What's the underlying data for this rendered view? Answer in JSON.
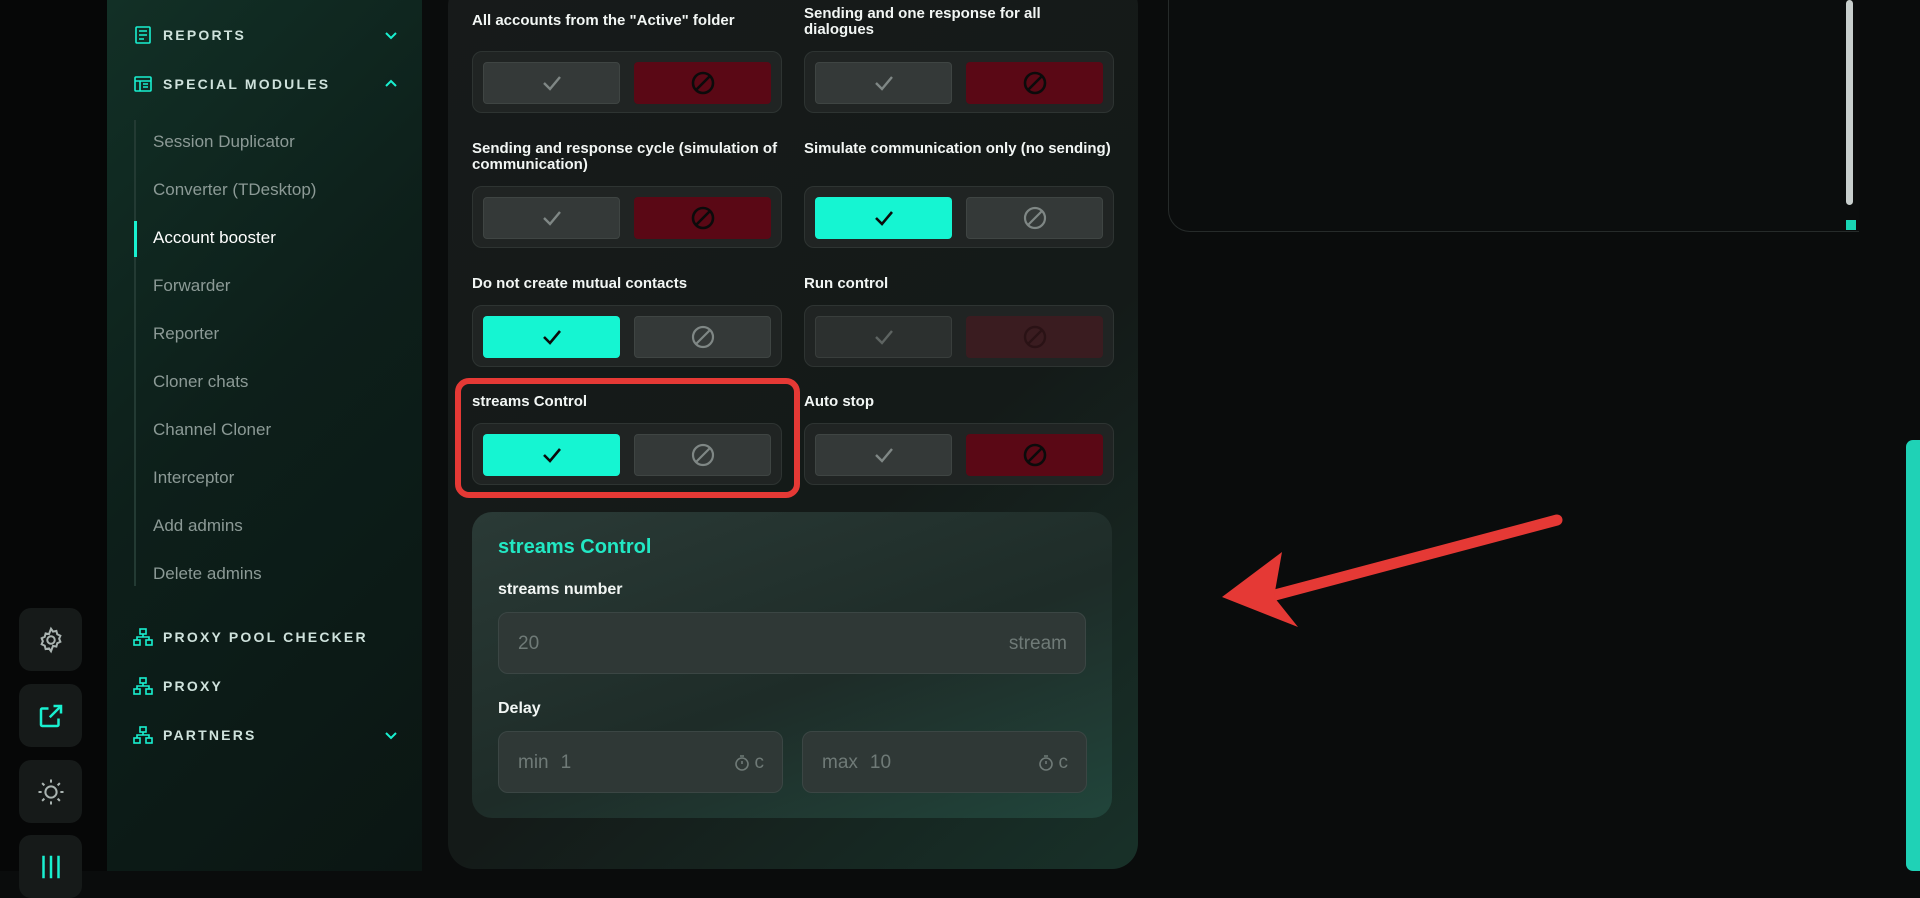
{
  "sidebar": {
    "sections": [
      {
        "title": "REPORTS",
        "icon": "report-icon",
        "expanded": false
      },
      {
        "title": "SPECIAL MODULES",
        "icon": "modules-icon",
        "expanded": true
      },
      {
        "title": "PROXY POOL CHECKER",
        "icon": "network-icon",
        "expanded": false
      },
      {
        "title": "PROXY",
        "icon": "network-icon",
        "expanded": false
      },
      {
        "title": "PARTNERS",
        "icon": "network-icon",
        "expanded": false
      }
    ],
    "submenu": [
      "Session Duplicator",
      "Converter (TDesktop)",
      "Account booster",
      "Forwarder",
      "Reporter",
      "Cloner chats",
      "Channel Cloner",
      "Interceptor",
      "Add admins",
      "Delete admins"
    ],
    "active_item": "Account booster"
  },
  "iconbar": [
    "gear-icon",
    "external-link-icon",
    "theme-icon",
    "sliders-icon"
  ],
  "options": [
    {
      "label": "All accounts from the \"Active\" folder",
      "state": "no"
    },
    {
      "label": "Sending and one response for all dialogues",
      "state": "no"
    },
    {
      "label": "Sending and response cycle (simulation of communication)",
      "state": "no"
    },
    {
      "label": "Simulate communication only (no sending)",
      "state": "yes"
    },
    {
      "label": "Do not create mutual contacts",
      "state": "yes"
    },
    {
      "label": "Run control",
      "state": "disabled"
    },
    {
      "label": "streams Control",
      "state": "yes",
      "highlighted": true
    },
    {
      "label": "Auto stop",
      "state": "no"
    }
  ],
  "streams_control": {
    "title": "streams Control",
    "streams_label": "streams number",
    "streams_value": "20",
    "streams_unit": "stream",
    "delay_label": "Delay",
    "min_prefix": "min",
    "min_value": "1",
    "max_prefix": "max",
    "max_value": "10",
    "time_unit": "c"
  },
  "colors": {
    "accent": "#15f5d2",
    "danger": "#5a0815",
    "annotation": "#e53935"
  }
}
